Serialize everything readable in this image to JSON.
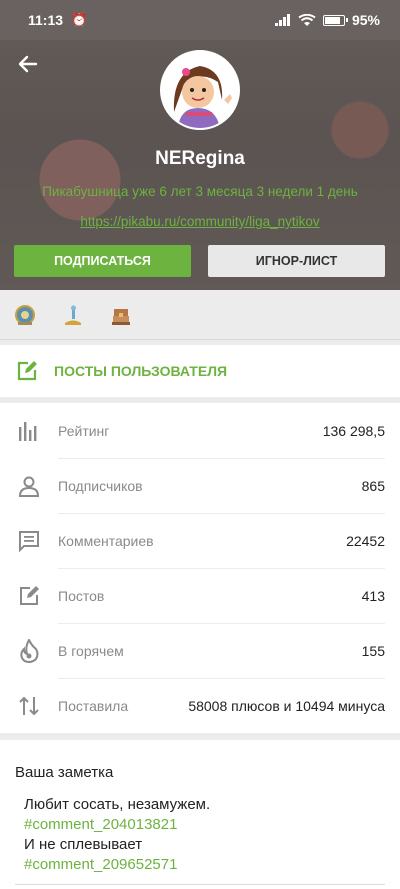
{
  "status_bar": {
    "time": "11:13",
    "battery": "95%"
  },
  "profile": {
    "username": "NERegina",
    "tenure": "Пикабушница уже 6 лет 3 месяца 3 недели 1 день",
    "link": "https://pikabu.ru/community/liga_nytikov",
    "subscribe_label": "ПОДПИСАТЬСЯ",
    "ignore_label": "ИГНОР-ЛИСТ"
  },
  "awards": [
    "award-medal-icon",
    "award-trophy-icon",
    "award-chest-icon"
  ],
  "posts_label": "ПОСТЫ ПОЛЬЗОВАТЕЛЯ",
  "stats": [
    {
      "icon": "rating-icon",
      "label": "Рейтинг",
      "value": "136 298,5"
    },
    {
      "icon": "user-icon",
      "label": "Подписчиков",
      "value": "865"
    },
    {
      "icon": "comment-icon",
      "label": "Комментариев",
      "value": "22452"
    },
    {
      "icon": "edit-icon",
      "label": "Постов",
      "value": "413"
    },
    {
      "icon": "fire-icon",
      "label": "В горячем",
      "value": "155"
    },
    {
      "icon": "arrows-updown-icon",
      "label": "Поставила",
      "value": "58008 плюсов и 10494 минуса"
    }
  ],
  "note": {
    "title": "Ваша заметка",
    "line1": "Любит сосать, незамужем.",
    "tag1": "#comment_204013821",
    "line2": "И не сплевывает",
    "tag2": "#comment_209652571"
  },
  "colors": {
    "accent": "#6db33f",
    "text_muted": "#8a8a8a"
  }
}
